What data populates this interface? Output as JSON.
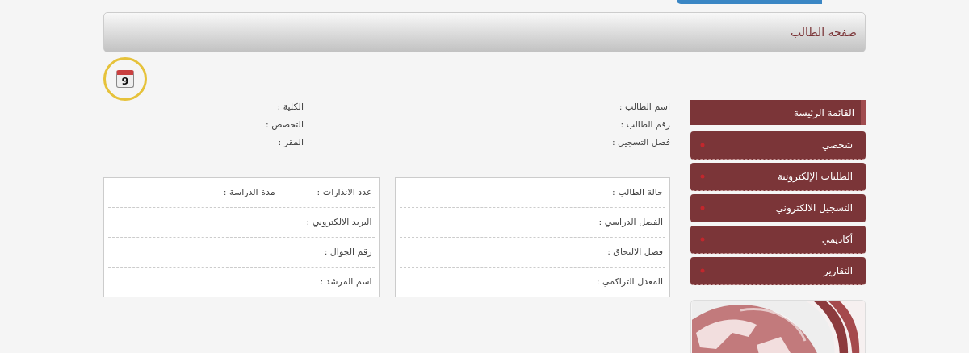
{
  "page_title": "صفحة الطالب",
  "calendar_day": "9",
  "info_columns": [
    [
      "اسم الطالب :",
      "رقم الطالب :",
      "فصل التسجيل :"
    ],
    [
      "الكلية :",
      "التخصص :",
      "المقر :"
    ]
  ],
  "detail_boxes": [
    [
      [
        "حالة الطالب :"
      ],
      [
        "الفصل الدراسي :"
      ],
      [
        "فصل الالتحاق :"
      ],
      [
        "المعدل التراكمي :"
      ]
    ],
    [
      [
        "عدد الانذارات :",
        "مدة الدراسة :"
      ],
      [
        "البريد الالكتروني :"
      ],
      [
        "رقم الجوال :"
      ],
      [
        "اسم المرشد :"
      ]
    ]
  ],
  "sidebar": {
    "heading": "القائمة الرئيسة",
    "items": [
      "شخصي",
      "الطلبات الإلكترونية",
      "التسجيل الالكتروني",
      "أكاديمي",
      "التقارير"
    ]
  }
}
